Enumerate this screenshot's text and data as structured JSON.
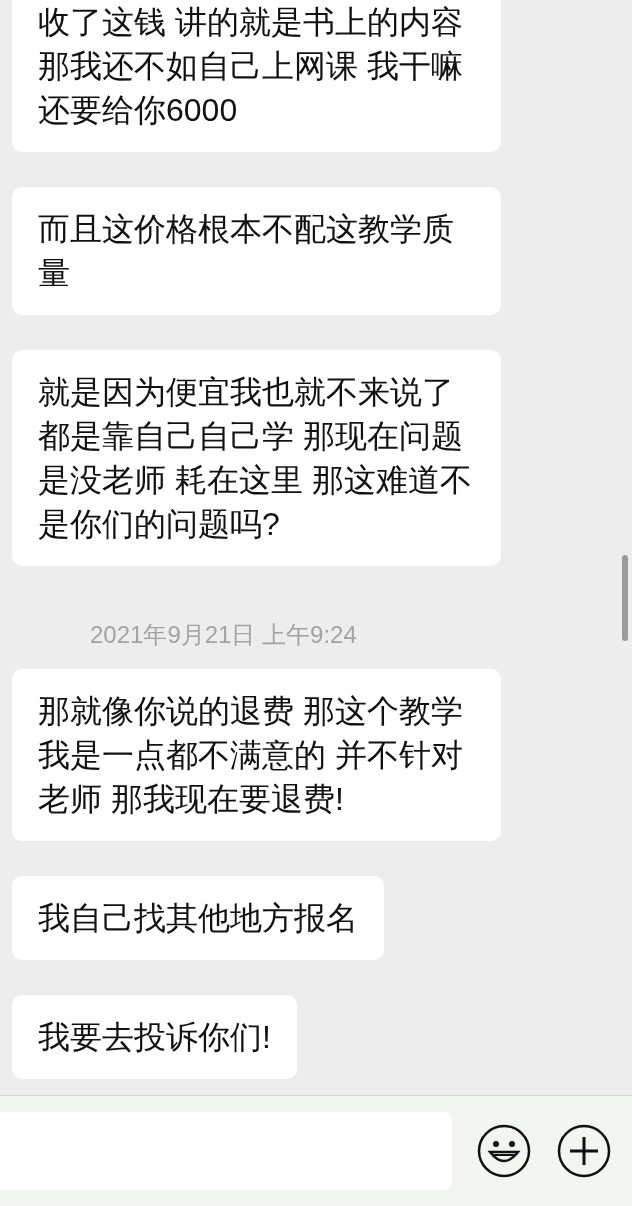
{
  "messages": [
    {
      "kind": "bubble",
      "text": "收了这钱 讲的就是书上的内容那我还不如自己上网课 我干嘛还要给你6000"
    },
    {
      "kind": "bubble",
      "text": "而且这价格根本不配这教学质量"
    },
    {
      "kind": "bubble",
      "text": "就是因为便宜我也就不来说了都是靠自己自己学 那现在问题是没老师 耗在这里 那这难道不是你们的问题吗?"
    },
    {
      "kind": "timestamp",
      "text": "2021年9月21日 上午9:24"
    },
    {
      "kind": "bubble",
      "text": "那就像你说的退费 那这个教学我是一点都不满意的 并不针对老师 那我现在要退费!"
    },
    {
      "kind": "bubble",
      "text": "我自己找其他地方报名"
    },
    {
      "kind": "bubble",
      "text": "我要去投诉你们!"
    }
  ]
}
